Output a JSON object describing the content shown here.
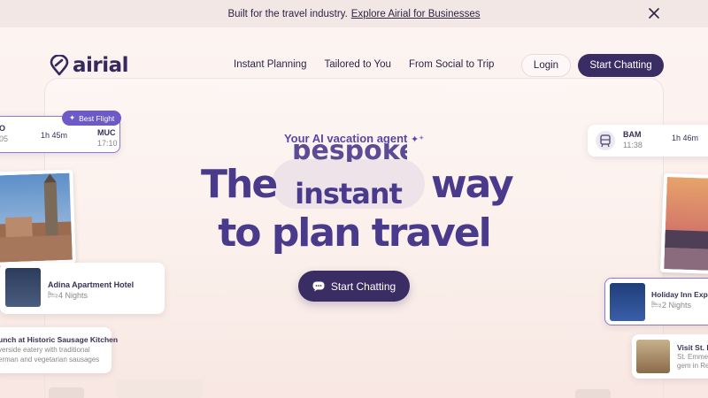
{
  "banner": {
    "text": "Built for the travel industry.",
    "link": "Explore Airial for Businesses"
  },
  "header": {
    "logo_text": "airial",
    "nav": [
      "Instant Planning",
      "Tailored to You",
      "From Social to Trip"
    ],
    "login": "Login",
    "start_chatting": "Start Chatting"
  },
  "hero": {
    "eyebrow": "Your AI vacation agent",
    "line1_start": "The",
    "rotating_prev": "bespoke",
    "rotating_word": "instant",
    "line1_end": "way",
    "line2": "to plan travel",
    "cta": "Start Chatting"
  },
  "cards": {
    "flight_left": {
      "badge": "Best Flight",
      "from_code": "O",
      "from_time": "05",
      "duration": "1h 45m",
      "to_code": "MUC",
      "to_time": "17:10"
    },
    "train_right": {
      "code": "BAM",
      "time": "11:38",
      "duration": "1h 46m"
    },
    "hotel_left": {
      "name": "Adina Apartment Hotel",
      "nights": "4 Nights"
    },
    "activity_left": {
      "title": "unch at Historic Sausage Kitchen",
      "desc1": "verside eatery with traditional",
      "desc2": "erman and vegetarian sausages"
    },
    "hotel_right": {
      "name": "Holiday Inn Expres",
      "nights": "2 Nights"
    },
    "activity_right": {
      "title": "Visit St. E",
      "desc1": "St. Emmer",
      "desc2": "gem in Re"
    }
  },
  "colors": {
    "brand": "#3a2d63",
    "accent": "#6d5ac9",
    "hero_text": "#4a3a8c",
    "background": "#fbeee9"
  }
}
